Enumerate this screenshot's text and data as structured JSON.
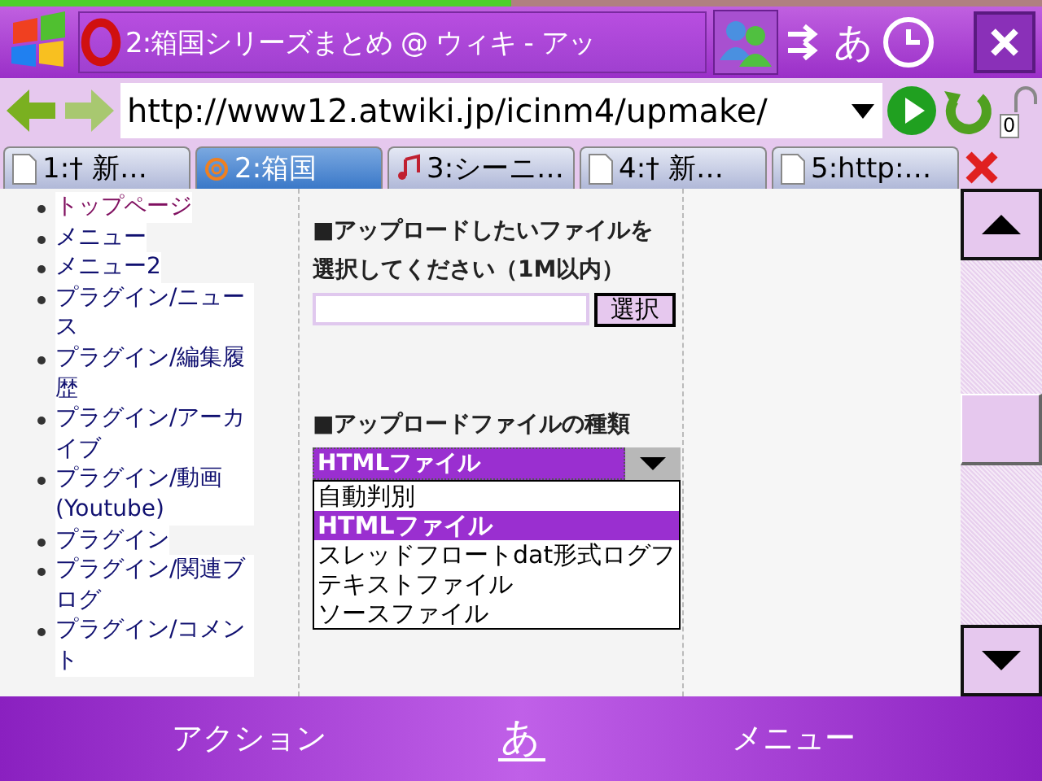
{
  "load_progress": {
    "level": 0.49
  },
  "title_bar": {
    "title": "2:箱国シリーズまとめ @ ウィキ - アッ",
    "input_mode": "あ"
  },
  "address_bar": {
    "url": "http://www12.atwiki.jp/icinm4/upmake/",
    "lock_count": "0"
  },
  "tabs": [
    {
      "label": "1:† 新…",
      "kind": "page",
      "selected": false
    },
    {
      "label": "2:箱国",
      "kind": "at",
      "selected": true
    },
    {
      "label": "3:シーニ…",
      "kind": "music",
      "selected": false
    },
    {
      "label": "4:† 新…",
      "kind": "page",
      "selected": false
    },
    {
      "label": "5:http:…",
      "kind": "page",
      "selected": false
    }
  ],
  "sidebar": {
    "items": [
      {
        "label": "トップページ",
        "visited": true
      },
      {
        "label": "メニュー",
        "visited": false
      },
      {
        "label": "メニュー2",
        "visited": false
      },
      {
        "label": "プラグイン/ニュース",
        "visited": false
      },
      {
        "label": "プラグイン/編集履歴",
        "visited": false
      },
      {
        "label": "プラグイン/アーカイブ",
        "visited": false
      },
      {
        "label": "プラグイン/動画(Youtube)",
        "visited": false
      },
      {
        "label": "プラグイン",
        "visited": false
      },
      {
        "label": "プラグイン/関連ブログ",
        "visited": false
      },
      {
        "label": "プラグイン/コメント",
        "visited": false
      }
    ]
  },
  "upload_form": {
    "file_heading": "■アップロードしたいファイルを選択してください（1M以内）",
    "choose_button": "選択",
    "type_heading": "■アップロードファイルの種類",
    "type_value": "HTMLファイル",
    "type_options": [
      {
        "label": "自動判別",
        "selected": false
      },
      {
        "label": "HTMLファイル",
        "selected": true
      },
      {
        "label": "スレッドフロートdat形式ログフ",
        "selected": false
      },
      {
        "label": "テキストファイル",
        "selected": false
      },
      {
        "label": "ソースファイル",
        "selected": false
      }
    ]
  },
  "softkeys": {
    "left": "アクション",
    "center": "あ",
    "right": "メニュー"
  }
}
